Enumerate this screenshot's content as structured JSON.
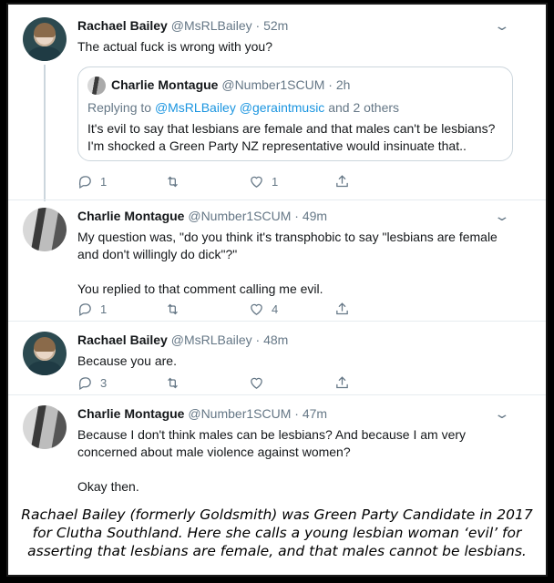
{
  "tweets": [
    {
      "name": "Rachael Bailey",
      "handle": "@MsRLBailey",
      "time": "· 52m",
      "text": "The actual fuck is wrong with you?",
      "quote": {
        "name": "Charlie Montague",
        "handle": "@Number1SCUM",
        "time": "· 2h",
        "reply_prefix": "Replying to ",
        "reply_targets": "@MsRLBailey @geraintmusic",
        "reply_suffix": " and 2 others",
        "text": "It's evil to say that lesbians are female and that males can't be lesbians? I'm shocked a Green Party NZ representative would insinuate that.."
      },
      "replies": "1",
      "retweets": "",
      "likes": "1"
    },
    {
      "name": "Charlie Montague",
      "handle": "@Number1SCUM",
      "time": "· 49m",
      "text": "My question was, \"do you think it's transphobic to say \"lesbians are female and don't willingly do dick\"?\"\n\nYou replied to that comment calling me evil.",
      "replies": "1",
      "retweets": "",
      "likes": "4"
    },
    {
      "name": "Rachael Bailey",
      "handle": "@MsRLBailey",
      "time": "· 48m",
      "text": "Because you are.",
      "replies": "3",
      "retweets": "",
      "likes": ""
    },
    {
      "name": "Charlie Montague",
      "handle": "@Number1SCUM",
      "time": "· 47m",
      "text": "Because I don't think males can be lesbians? And because I am very concerned about male violence against women?\n\nOkay then."
    }
  ],
  "caption": "Rachael Bailey (formerly Goldsmith) was Green Party Candidate in 2017 for Clutha Southland. Here she calls a young lesbian woman ‘evil’ for asserting that lesbians are female, and that males cannot be lesbians.",
  "icons": {
    "reply": "reply-icon",
    "retweet": "retweet-icon",
    "like": "heart-icon",
    "share": "share-icon",
    "more": "chevron-down-icon"
  },
  "colors": {
    "text": "#14171a",
    "muted": "#657786",
    "link": "#1b95e0",
    "border": "#ccd6dd"
  }
}
